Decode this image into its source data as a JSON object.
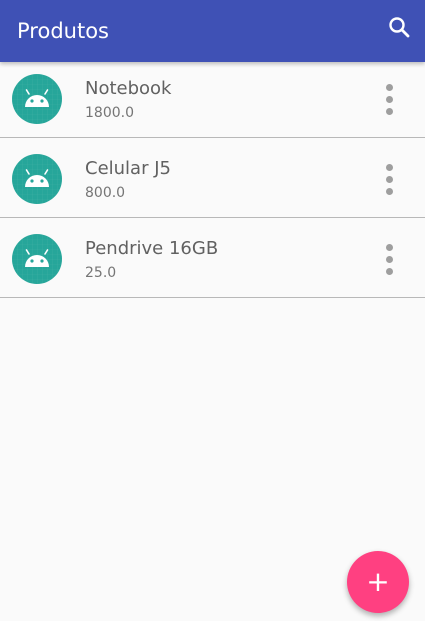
{
  "appbar": {
    "title": "Produtos",
    "background": "#3f51b5",
    "search_icon": "search-icon"
  },
  "products": [
    {
      "name": "Notebook",
      "price": "1800.0",
      "icon": "android-icon"
    },
    {
      "name": "Celular J5",
      "price": "800.0",
      "icon": "android-icon"
    },
    {
      "name": "Pendrive 16GB",
      "price": "25.0",
      "icon": "android-icon"
    }
  ],
  "more_icon": "more-vertical-icon",
  "fab": {
    "label": "+",
    "color": "#ff4081",
    "icon": "add-icon"
  },
  "colors": {
    "avatar_bg": "#26a69a",
    "android_green": "#ffffff"
  }
}
